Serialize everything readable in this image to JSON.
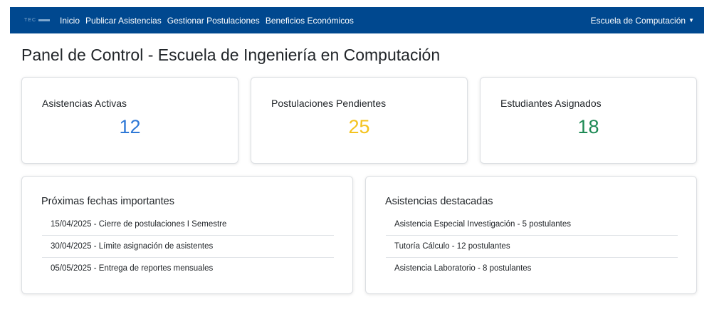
{
  "navbar": {
    "brand": "TEC",
    "links": [
      "Inicio",
      "Publicar Asistencias",
      "Gestionar Postulaciones",
      "Beneficios Económicos"
    ],
    "user_menu": "Escuela de Computación"
  },
  "page": {
    "title": "Panel de Control - Escuela de Ingeniería en Computación"
  },
  "stats": [
    {
      "label": "Asistencias Activas",
      "value": "12",
      "color": "#2e78d6"
    },
    {
      "label": "Postulaciones Pendientes",
      "value": "25",
      "color": "#f4c31e"
    },
    {
      "label": "Estudiantes Asignados",
      "value": "18",
      "color": "#1e8a55"
    }
  ],
  "dates_card": {
    "title": "Próximas fechas importantes",
    "items": [
      "15/04/2025 - Cierre de postulaciones I Semestre",
      "30/04/2025 - Límite asignación de asistentes",
      "05/05/2025 - Entrega de reportes mensuales"
    ]
  },
  "featured_card": {
    "title": "Asistencias destacadas",
    "items": [
      "Asistencia Especial Investigación - 5 postulantes",
      "Tutoría Cálculo - 12 postulantes",
      "Asistencia Laboratorio - 8 postulantes"
    ]
  }
}
